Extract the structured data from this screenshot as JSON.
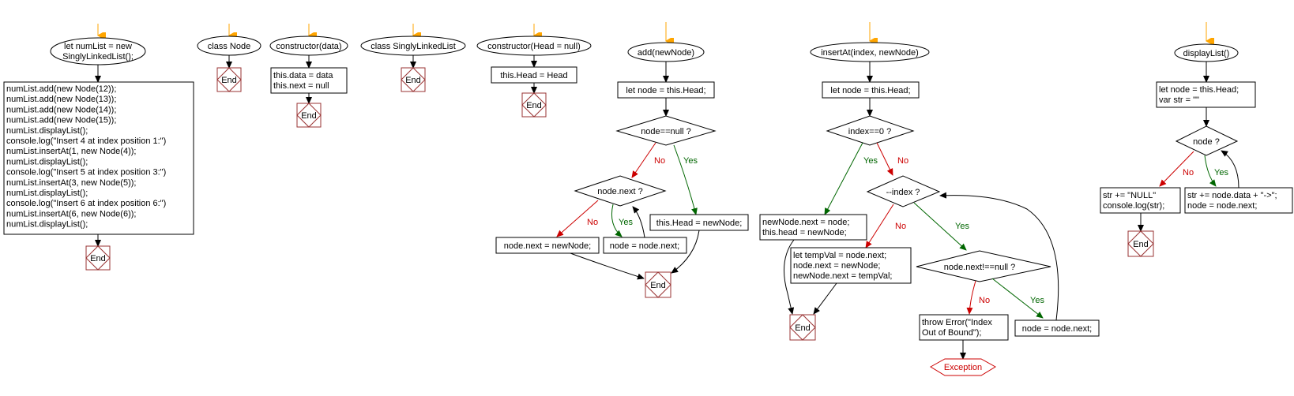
{
  "labels": {
    "end": "End",
    "yes": "Yes",
    "no": "No",
    "exception": "Exception"
  },
  "colors": {
    "start_arrow": "#ffa500",
    "end_border": "#993333",
    "no_branch": "#cc0000",
    "yes_branch": "#006600"
  },
  "flows": {
    "main": {
      "start_lines": [
        "let numList = new",
        "SinglyLinkedList();"
      ],
      "body_lines": [
        "numList.add(new Node(12));",
        "numList.add(new Node(13));",
        "numList.add(new Node(14));",
        "numList.add(new Node(15));",
        "numList.displayList();",
        "console.log(\"Insert 4 at index position 1:\")",
        "numList.insertAt(1, new Node(4));",
        "numList.displayList();",
        "console.log(\"Insert 5 at index position 3:\")",
        "numList.insertAt(3, new Node(5));",
        "numList.displayList();",
        "console.log(\"Insert 6 at index position 6:\")",
        "numList.insertAt(6, new Node(6));",
        "numList.displayList();"
      ]
    },
    "class_node": {
      "start": "class Node"
    },
    "node_constructor": {
      "start": "constructor(data)",
      "body_lines": [
        "this.data = data",
        "this.next = null"
      ]
    },
    "class_list": {
      "start": "class SinglyLinkedList"
    },
    "list_constructor": {
      "start": "constructor(Head = null)",
      "body": "this.Head = Head"
    },
    "add": {
      "start": "add(newNode)",
      "init": "let node = this.Head;",
      "cond1": "node==null ?",
      "cond2": "node.next ?",
      "yes1": "this.Head = newNode;",
      "no2": "node.next = newNode;",
      "yes2": "node = node.next;"
    },
    "insertAt": {
      "start": "insertAt(index, newNode)",
      "init": "let node = this.Head;",
      "cond1": "index==0 ?",
      "yes1_lines": [
        "newNode.next = node;",
        "this.head = newNode;"
      ],
      "cond2": "--index ?",
      "no2_lines": [
        "let tempVal = node.next;",
        "node.next = newNode;",
        "newNode.next = tempVal;"
      ],
      "cond3": "node.next!==null ?",
      "no3_lines": [
        "throw Error(\"Index",
        "Out of Bound\");"
      ],
      "yes3": "node = node.next;"
    },
    "displayList": {
      "start": "displayList()",
      "init_lines": [
        "let node = this.Head;",
        "var str = \"\""
      ],
      "cond": "node ?",
      "no_lines": [
        "str += \"NULL\"",
        "console.log(str);"
      ],
      "yes_lines": [
        "str += node.data + \"->\";",
        "node = node.next;"
      ]
    }
  }
}
